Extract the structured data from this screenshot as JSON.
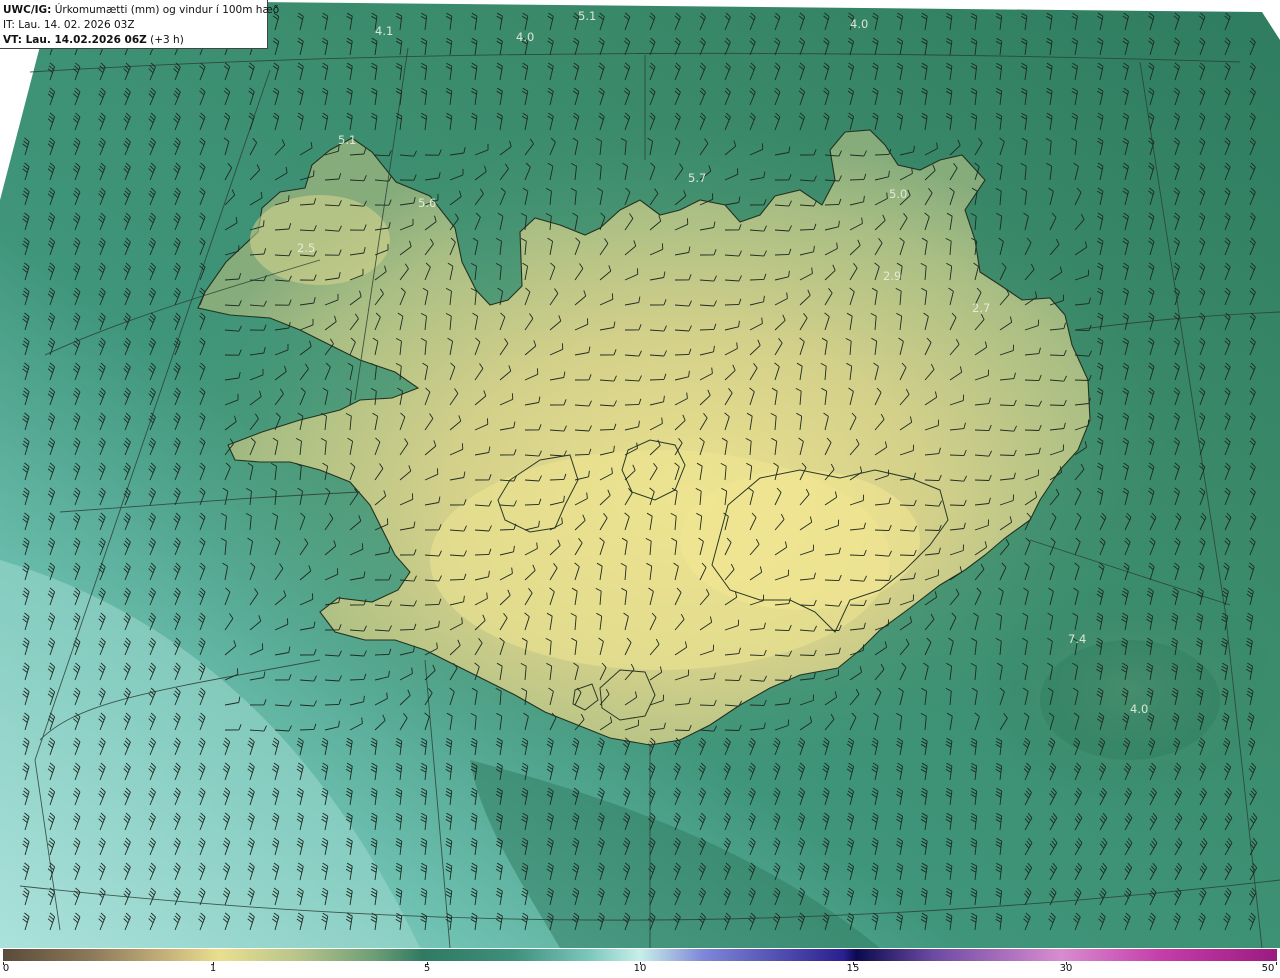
{
  "header": {
    "model": "UWC/IG:",
    "title": "Úrkomumætti (mm) og vindur í 100m hæð",
    "it": "IT: Lau. 14. 02. 2026 03Z",
    "vt_bold": "VT: Lau. 14.02.2026 06Z",
    "vt_extra": "(+3 h)"
  },
  "colorbar": {
    "ticks": [
      "0",
      "1",
      "5",
      "10",
      "15",
      "30",
      "50"
    ]
  },
  "map": {
    "values": [
      "5.1",
      "4.1",
      "4.0",
      "4.0",
      "5.1",
      "5.6",
      "5.7",
      "5.0",
      "2.5",
      "2.9",
      "2.7",
      "7.4",
      "4.0"
    ]
  },
  "colors": {
    "land_high": "#e4dc8c",
    "land_mid": "#b6c385",
    "sea_green": "#3a8a6c",
    "sea_dark": "#2e7a5e",
    "sea_light": "#aee6e0",
    "coast": "#2b3a2a",
    "barb": "#1f2a22"
  }
}
